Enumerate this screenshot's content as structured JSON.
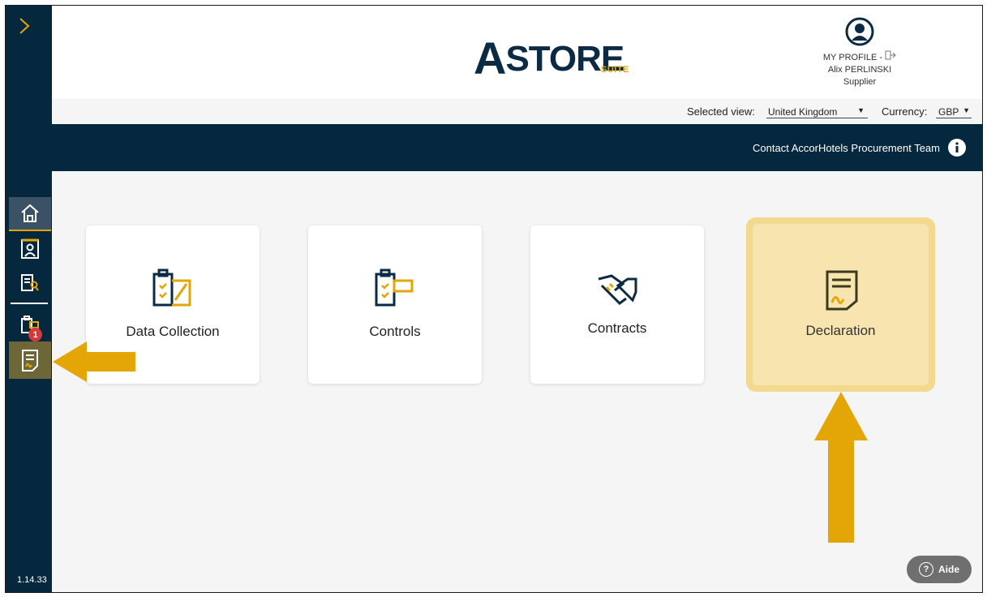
{
  "app": {
    "logo_main_initial": "A",
    "logo_main_rest": "STORE",
    "logo_sub": "SUITE",
    "version": "1.14.33"
  },
  "profile": {
    "line1": "MY PROFILE -",
    "name": "Alix PERLINSKI",
    "role": "Supplier"
  },
  "view_selector": {
    "label": "Selected view:",
    "value": "United Kingdom"
  },
  "currency_selector": {
    "label": "Currency:",
    "value": "GBP"
  },
  "navbar": {
    "contact": "Contact AccorHotels Procurement Team"
  },
  "sidebar": {
    "badge_count": "1"
  },
  "cards": [
    {
      "label": "Data Collection"
    },
    {
      "label": "Controls"
    },
    {
      "label": "Contracts"
    },
    {
      "label": "Declaration"
    }
  ],
  "help": {
    "label": "Aide"
  },
  "colors": {
    "navy": "#05283f",
    "accent": "#e3a606",
    "highlight": "#f7e4ae"
  }
}
